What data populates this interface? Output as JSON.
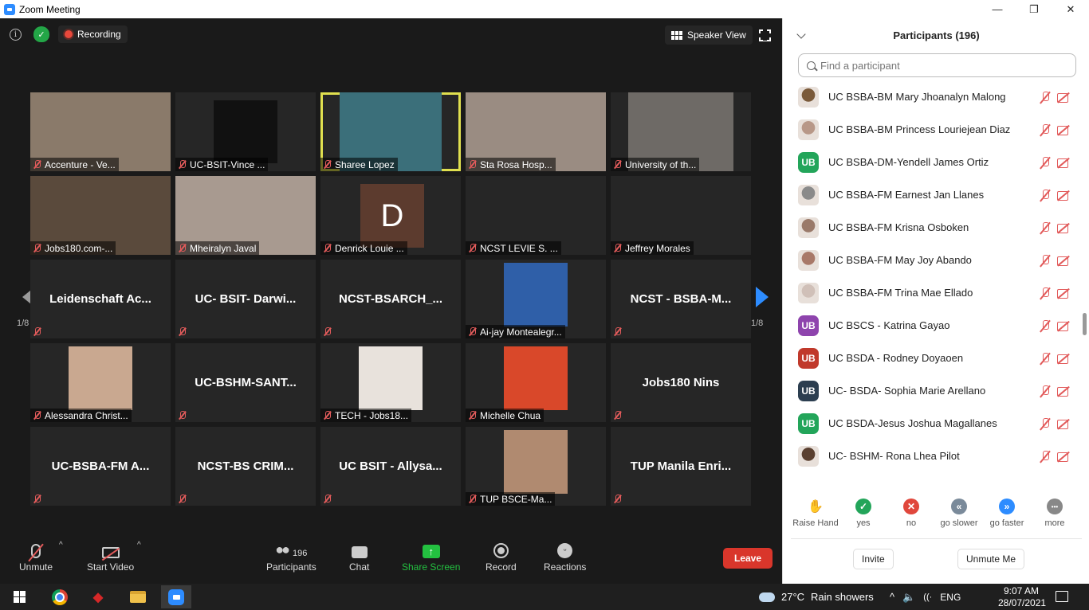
{
  "window": {
    "title": "Zoom Meeting",
    "controls": [
      "—",
      "❐",
      "✕"
    ]
  },
  "meeting": {
    "recording_label": "Recording",
    "view_label": "Speaker View",
    "page_left": "1/8",
    "page_right": "1/8"
  },
  "tiles": [
    {
      "label": "Accenture - Ve...",
      "kind": "photo",
      "color": "#8a7a6a"
    },
    {
      "label": "UC-BSIT-Vince ...",
      "kind": "photo",
      "color": "#111111"
    },
    {
      "label": "Sharee Lopez",
      "kind": "photo",
      "color": "#3b6f7a",
      "active": true
    },
    {
      "label": "Sta Rosa Hosp...",
      "kind": "photo",
      "color": "#9a8c82"
    },
    {
      "label": "University of th...",
      "kind": "photo",
      "color": "#6e6a66"
    },
    {
      "label": "Jobs180.com-...",
      "kind": "photo",
      "color": "#5a4a3c"
    },
    {
      "label": "Mheiralyn Javal",
      "kind": "photo",
      "color": "#a89a90"
    },
    {
      "label": "Denrick Louie ...",
      "kind": "letter",
      "letter": "D"
    },
    {
      "label": "NCST LEVIE S. ...",
      "kind": "empty"
    },
    {
      "label": "Jeffrey Morales",
      "kind": "empty"
    },
    {
      "big": "Leidenschaft Ac...",
      "kind": "name"
    },
    {
      "big": "UC- BSIT- Darwi...",
      "kind": "name"
    },
    {
      "big": "NCST-BSARCH_...",
      "kind": "name"
    },
    {
      "label": "Ai-jay Montealegr...",
      "kind": "avatar",
      "color": "#2f5fa8"
    },
    {
      "big": "NCST - BSBA-M...",
      "kind": "name"
    },
    {
      "label": "Alessandra Christ...",
      "kind": "avatar",
      "color": "#c9a890"
    },
    {
      "big": "UC-BSHM-SANT...",
      "kind": "name"
    },
    {
      "label": "TECH - Jobs18...",
      "kind": "avatar",
      "color": "#e8e2dc"
    },
    {
      "label": "Michelle Chua",
      "kind": "avatar",
      "color": "#d9482a"
    },
    {
      "big": "Jobs180 Nins",
      "kind": "name"
    },
    {
      "big": "UC-BSBA-FM A...",
      "kind": "name"
    },
    {
      "big": "NCST-BS CRIM...",
      "kind": "name"
    },
    {
      "big": "UC BSIT - Allysa...",
      "kind": "name"
    },
    {
      "label": "TUP BSCE-Ma...",
      "kind": "avatar",
      "color": "#b08a70"
    },
    {
      "big": "TUP Manila Enri...",
      "kind": "name"
    }
  ],
  "toolbar": {
    "unmute": "Unmute",
    "start_video": "Start Video",
    "participants": "Participants",
    "participants_count": "196",
    "chat": "Chat",
    "share_screen": "Share Screen",
    "record": "Record",
    "reactions": "Reactions",
    "leave": "Leave"
  },
  "panel": {
    "title": "Participants (196)",
    "search_placeholder": "Find a participant",
    "participants": [
      {
        "name": "UC BSBA-BM Mary Jhoanalyn Malong",
        "avatar": "photo",
        "color": "#7a5a3a"
      },
      {
        "name": "UC BSBA-BM Princess Louriejean Diaz",
        "avatar": "photo",
        "color": "#b89888"
      },
      {
        "name": "UC BSBA-DM-Yendell James Ortiz",
        "avatar": "UB",
        "color": "#23a55a"
      },
      {
        "name": "UC BSBA-FM Earnest Jan Llanes",
        "avatar": "photo",
        "color": "#8a8a8a"
      },
      {
        "name": "UC BSBA-FM Krisna Osboken",
        "avatar": "photo",
        "color": "#9a7a6a"
      },
      {
        "name": "UC BSBA-FM May Joy Abando",
        "avatar": "photo",
        "color": "#a87868"
      },
      {
        "name": "UC BSBA-FM Trina Mae Ellado",
        "avatar": "photo",
        "color": "#d0c0b8"
      },
      {
        "name": "UC BSCS - Katrina Gayao",
        "avatar": "UB",
        "color": "#8e44ad"
      },
      {
        "name": "UC BSDA - Rodney Doyaoen",
        "avatar": "UB",
        "color": "#c0392b"
      },
      {
        "name": "UC- BSDA- Sophia Marie Arellano",
        "avatar": "UB",
        "color": "#2c3e50"
      },
      {
        "name": "UC BSDA-Jesus Joshua Magallanes",
        "avatar": "UB",
        "color": "#23a55a"
      },
      {
        "name": "UC- BSHM- Rona Lhea Pilot",
        "avatar": "photo",
        "color": "#5a4030"
      }
    ],
    "reactions": [
      {
        "label": "Raise Hand",
        "glyph": "✋",
        "color": "#2d8cff",
        "icon": "raise-hand-icon"
      },
      {
        "label": "yes",
        "glyph": "✓",
        "color": "#23a55a",
        "icon": "yes-icon"
      },
      {
        "label": "no",
        "glyph": "✕",
        "color": "#e0473c",
        "icon": "no-icon"
      },
      {
        "label": "go slower",
        "glyph": "«",
        "color": "#7a8a9a",
        "icon": "go-slower-icon"
      },
      {
        "label": "go faster",
        "glyph": "»",
        "color": "#2d8cff",
        "icon": "go-faster-icon"
      },
      {
        "label": "more",
        "glyph": "•••",
        "color": "#888888",
        "icon": "more-icon"
      }
    ],
    "invite": "Invite",
    "unmute_me": "Unmute Me"
  },
  "taskbar": {
    "temperature": "27°C",
    "weather": "Rain showers",
    "lang": "ENG",
    "time": "9:07 AM",
    "date": "28/07/2021"
  }
}
